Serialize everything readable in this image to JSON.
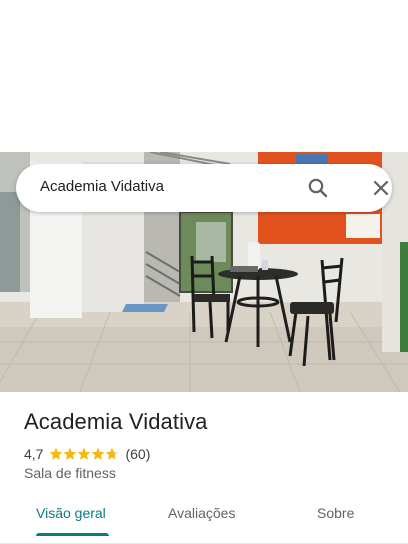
{
  "search": {
    "query": "Academia Vidativa"
  },
  "icons": {
    "search": "search-icon",
    "close": "close-icon",
    "star": "star-icon"
  },
  "place": {
    "name": "Academia Vidativa",
    "rating": "4,7",
    "rating_value": 4.7,
    "review_count": "(60)",
    "category": "Sala de fitness"
  },
  "tabs": [
    {
      "label": "Visão geral",
      "active": true
    },
    {
      "label": "Avaliações",
      "active": false
    },
    {
      "label": "Sobre",
      "active": false
    }
  ],
  "colors": {
    "accent": "#0b7a80",
    "star": "#f5b90b",
    "wall_orange": "#e2521f"
  }
}
